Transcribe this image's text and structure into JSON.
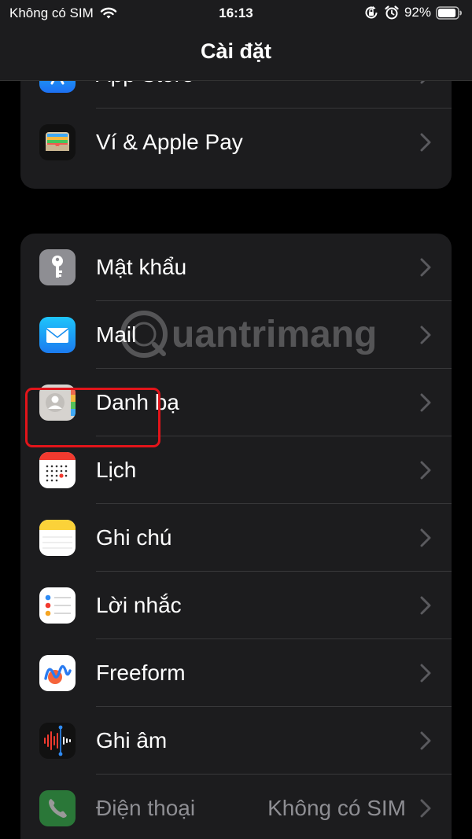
{
  "status_bar": {
    "carrier": "Không có SIM",
    "time": "16:13",
    "battery": "92%",
    "battery_level": 0.92,
    "icons": [
      "wifi-icon",
      "orientation-lock-icon",
      "alarm-icon",
      "battery-icon"
    ]
  },
  "nav": {
    "title": "Cài đặt"
  },
  "groups": [
    {
      "items": [
        {
          "label": "App Store",
          "icon": "app-store-icon",
          "value": ""
        },
        {
          "label": "Ví & Apple Pay",
          "icon": "wallet-icon",
          "value": ""
        }
      ]
    },
    {
      "items": [
        {
          "label": "Mật khẩu",
          "icon": "key-icon",
          "value": ""
        },
        {
          "label": "Mail",
          "icon": "mail-icon",
          "value": "",
          "highlighted": true
        },
        {
          "label": "Danh bạ",
          "icon": "contacts-icon",
          "value": ""
        },
        {
          "label": "Lịch",
          "icon": "calendar-icon",
          "value": ""
        },
        {
          "label": "Ghi chú",
          "icon": "notes-icon",
          "value": ""
        },
        {
          "label": "Lời nhắc",
          "icon": "reminders-icon",
          "value": ""
        },
        {
          "label": "Freeform",
          "icon": "freeform-icon",
          "value": ""
        },
        {
          "label": "Ghi âm",
          "icon": "voice-memos-icon",
          "value": ""
        },
        {
          "label": "Điện thoại",
          "icon": "phone-icon",
          "value": "Không có SIM",
          "disabled": true
        }
      ]
    }
  ],
  "watermark": {
    "text": "uantrimang",
    "icon": "watermark-logo-icon"
  },
  "colors": {
    "background": "#000000",
    "cell": "#1c1c1e",
    "separator": "#38383a",
    "secondary_text": "#8e8e93",
    "highlight": "#e2141a"
  }
}
